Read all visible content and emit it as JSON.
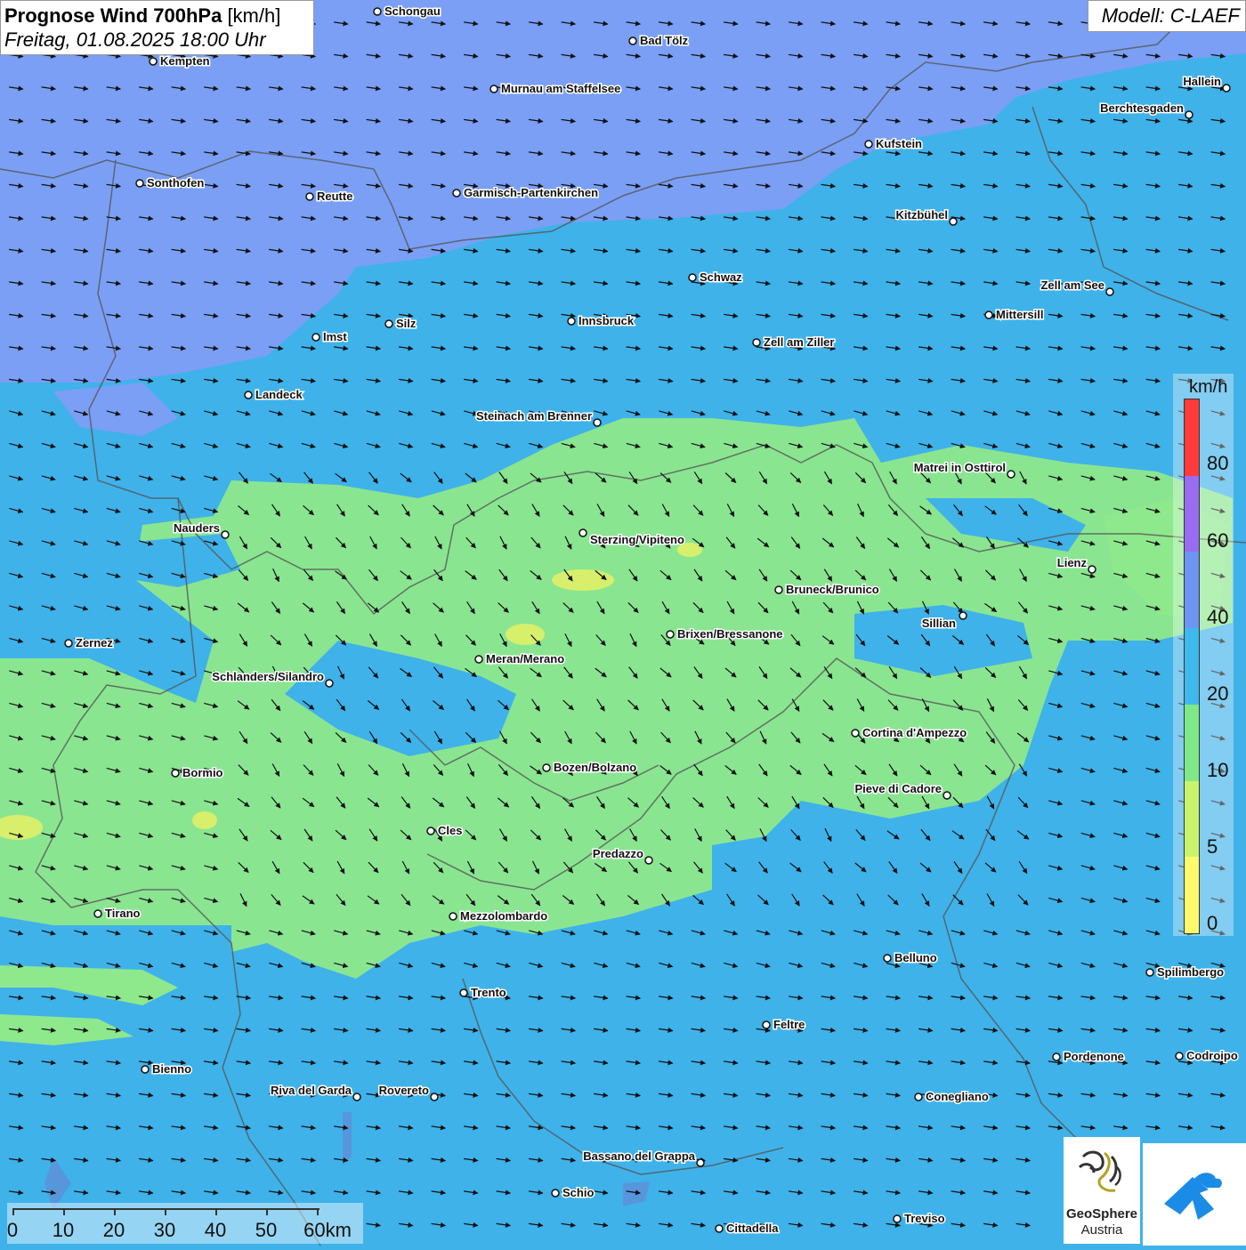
{
  "header": {
    "title_bold": "Prognose Wind 700hPa",
    "title_unit": "[km/h]",
    "subtitle": "Freitag, 01.08.2025 18:00 Uhr"
  },
  "model_label": "Modell: C-LAEF",
  "legend": {
    "unit": "km/h",
    "ticks": [
      "80",
      "60",
      "40",
      "20",
      "10",
      "5",
      "0"
    ],
    "colors": [
      "#ff3b3b",
      "#9a6cf2",
      "#6d95f2",
      "#3fb8ec",
      "#7fe887",
      "#c9f36a",
      "#fcfa6a"
    ]
  },
  "scale_bar": {
    "labels": [
      "0",
      "10",
      "20",
      "30",
      "40",
      "50",
      "60km"
    ]
  },
  "logos": {
    "geosphere_line1": "GeoSphere",
    "geosphere_line2": "Austria"
  },
  "colors": {
    "strong_wind": "#7a9ff5",
    "medium_wind": "#3fb2ea",
    "light_wind": "#8ee88c",
    "calm": "#e6f26b"
  },
  "cities": [
    {
      "name": "Schongau",
      "side": "right"
    },
    {
      "name": "Bad Tölz",
      "side": "right"
    },
    {
      "name": "Kempten",
      "side": "right"
    },
    {
      "name": "Murnau am Staffelsee",
      "side": "right"
    },
    {
      "name": "Hallein",
      "side": "left"
    },
    {
      "name": "Berchtesgaden",
      "side": "left"
    },
    {
      "name": "Kufstein",
      "side": "right"
    },
    {
      "name": "Sonthofen",
      "side": "right"
    },
    {
      "name": "Reutte",
      "side": "right"
    },
    {
      "name": "Garmisch-Partenkirchen",
      "side": "right"
    },
    {
      "name": "Kitzbühel",
      "side": "left"
    },
    {
      "name": "Schwaz",
      "side": "right"
    },
    {
      "name": "Zell am See",
      "side": "left"
    },
    {
      "name": "Mittersill",
      "side": "right"
    },
    {
      "name": "Silz",
      "side": "right"
    },
    {
      "name": "Innsbruck",
      "side": "right"
    },
    {
      "name": "Imst",
      "side": "right"
    },
    {
      "name": "Zell am Ziller",
      "side": "right"
    },
    {
      "name": "Landeck",
      "side": "right"
    },
    {
      "name": "Steinach am Brenner",
      "side": "left"
    },
    {
      "name": "Matrei in Osttirol",
      "side": "left"
    },
    {
      "name": "Nauders",
      "side": "left"
    },
    {
      "name": "Sterzing/Vipiteno",
      "side": "right-below"
    },
    {
      "name": "Lienz",
      "side": "left"
    },
    {
      "name": "Bruneck/Brunico",
      "side": "right"
    },
    {
      "name": "Sillian",
      "side": "left-below"
    },
    {
      "name": "Zernez",
      "side": "right"
    },
    {
      "name": "Brixen/Bressanone",
      "side": "right"
    },
    {
      "name": "Meran/Merano",
      "side": "right"
    },
    {
      "name": "Schlanders/Silandro",
      "side": "left"
    },
    {
      "name": "Cortina d'Ampezzo",
      "side": "right"
    },
    {
      "name": "Bozen/Bolzano",
      "side": "right"
    },
    {
      "name": "Bormio",
      "side": "right"
    },
    {
      "name": "Pieve di Cadore",
      "side": "left"
    },
    {
      "name": "Cles",
      "side": "right"
    },
    {
      "name": "Predazzo",
      "side": "left"
    },
    {
      "name": "Tirano",
      "side": "right"
    },
    {
      "name": "Mezzolombardo",
      "side": "right"
    },
    {
      "name": "Belluno",
      "side": "right"
    },
    {
      "name": "Spilimbergo",
      "side": "right"
    },
    {
      "name": "Trento",
      "side": "right"
    },
    {
      "name": "Feltre",
      "side": "right"
    },
    {
      "name": "Bienno",
      "side": "right"
    },
    {
      "name": "Pordenone",
      "side": "right"
    },
    {
      "name": "Codroipo",
      "side": "right"
    },
    {
      "name": "Riva del Garda",
      "side": "left"
    },
    {
      "name": "Rovereto",
      "side": "left"
    },
    {
      "name": "Conegliano",
      "side": "right"
    },
    {
      "name": "Bassano del Grappa",
      "side": "left"
    },
    {
      "name": "Schio",
      "side": "right"
    },
    {
      "name": "Treviso",
      "side": "right"
    },
    {
      "name": "Cittadella",
      "side": "right"
    }
  ]
}
